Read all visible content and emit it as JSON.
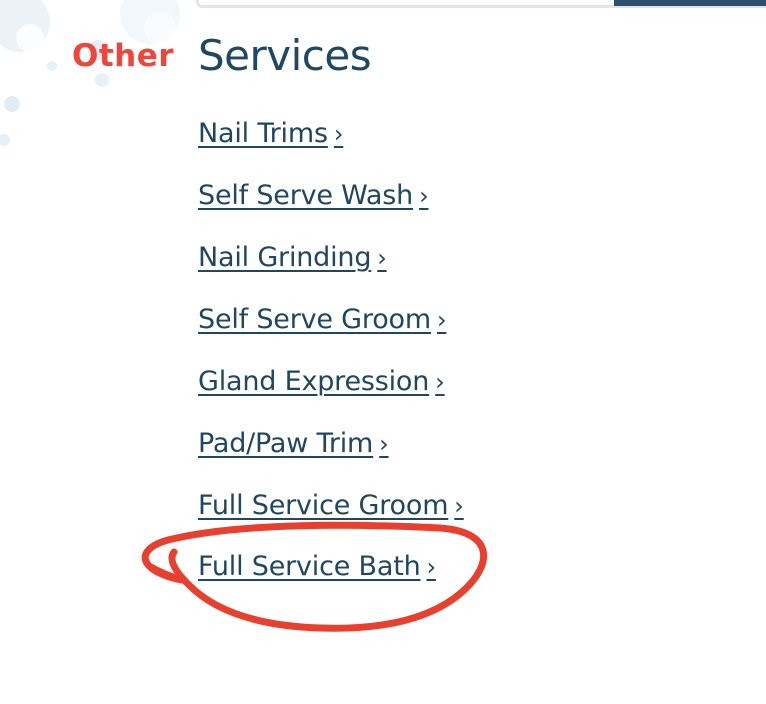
{
  "heading": {
    "accent": "Other",
    "main": "Services"
  },
  "services": [
    {
      "label": "Nail Trims",
      "chevron": "›"
    },
    {
      "label": "Self Serve Wash",
      "chevron": "›"
    },
    {
      "label": "Nail Grinding",
      "chevron": "›"
    },
    {
      "label": "Self Serve Groom",
      "chevron": "›"
    },
    {
      "label": "Gland Expression",
      "chevron": "›"
    },
    {
      "label": "Pad/Paw Trim",
      "chevron": "›"
    },
    {
      "label": "Full Service Groom",
      "chevron": "›"
    },
    {
      "label": "Full Service Bath",
      "chevron": "›"
    }
  ],
  "colors": {
    "accent": "#f0453a",
    "heading": "#1f4862",
    "link": "#20475f",
    "annotation": "#e8402f"
  },
  "icons": {
    "decoration": "bubbles-icon",
    "link_chevron": "chevron-right-icon"
  }
}
